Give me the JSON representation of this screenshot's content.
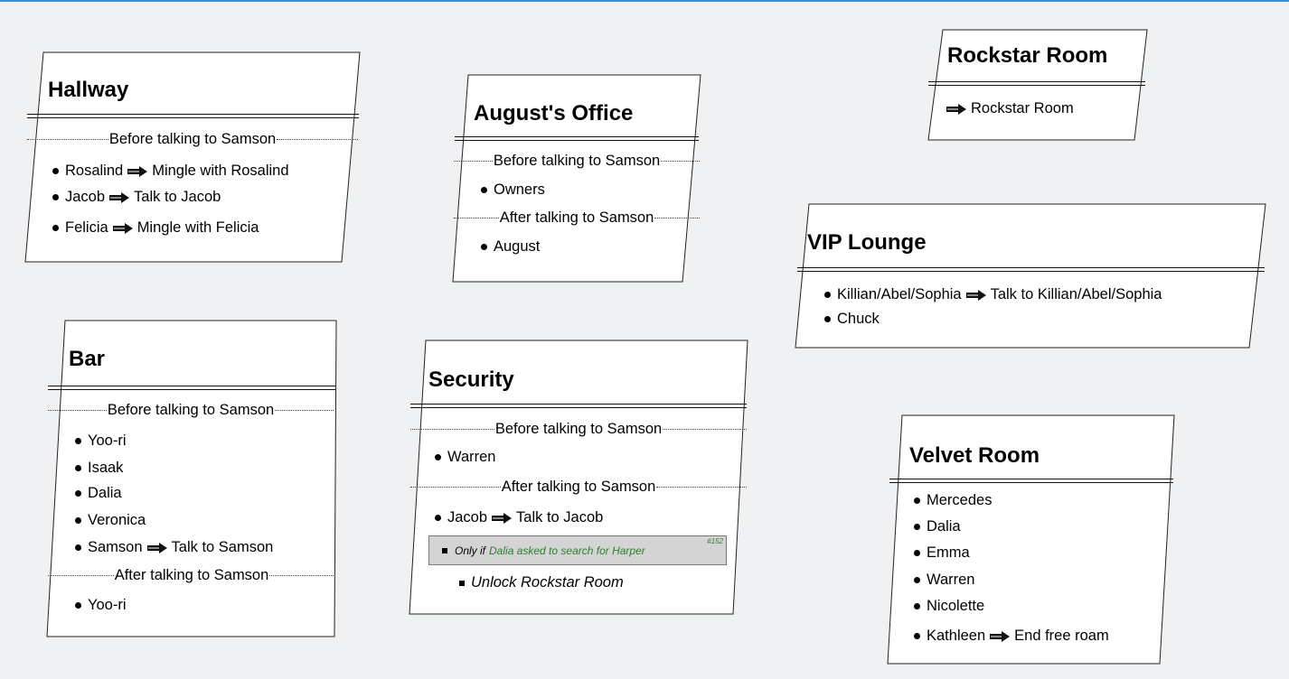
{
  "rooms": {
    "hallway": {
      "title": "Hallway",
      "sep_before": "Before talking to Samson",
      "items": [
        {
          "name": "Rosalind",
          "action": "Mingle with Rosalind"
        },
        {
          "name": "Jacob",
          "action": "Talk to Jacob"
        },
        {
          "name": "Felicia",
          "action": "Mingle with Felicia"
        }
      ]
    },
    "augusts_office": {
      "title": "August's Office",
      "sep_before": "Before talking to Samson",
      "before_items": [
        "Owners"
      ],
      "sep_after": "After talking to Samson",
      "after_items": [
        "August"
      ]
    },
    "rockstar_room": {
      "title": "Rockstar Room",
      "link": "Rockstar Room"
    },
    "vip_lounge": {
      "title": "VIP Lounge",
      "items": [
        {
          "name": "Killian/Abel/Sophia",
          "action": "Talk to Killian/Abel/Sophia"
        },
        {
          "name": "Chuck"
        }
      ]
    },
    "bar": {
      "title": "Bar",
      "sep_before": "Before talking to Samson",
      "before_items": [
        "Yoo-ri",
        "Isaak",
        "Dalia",
        "Veronica"
      ],
      "samson": {
        "name": "Samson",
        "action": "Talk to Samson"
      },
      "sep_after": "After talking to Samson",
      "after_items": [
        "Yoo-ri"
      ]
    },
    "security": {
      "title": "Security",
      "sep_before": "Before talking to Samson",
      "before_items": [
        "Warren"
      ],
      "sep_after": "After talking to Samson",
      "jacob": {
        "name": "Jacob",
        "action": "Talk to Jacob"
      },
      "condition": {
        "prefix": "Only if",
        "text": "Dalia asked to search for Harper",
        "ref": "#152"
      },
      "unlock": "Unlock Rockstar Room"
    },
    "velvet_room": {
      "title": "Velvet Room",
      "items": [
        "Mercedes",
        "Dalia",
        "Emma",
        "Warren",
        "Nicolette"
      ],
      "kathleen": {
        "name": "Kathleen",
        "action": "End free roam"
      }
    }
  },
  "colors": {
    "header_bar": "#3d8fd0",
    "background": "#eff1f3",
    "condition_bg": "#d4d4d4",
    "condition_text": "#2f7d2f"
  },
  "icons": {
    "arrow": "arrow-icon",
    "bullet": "bullet-icon"
  }
}
